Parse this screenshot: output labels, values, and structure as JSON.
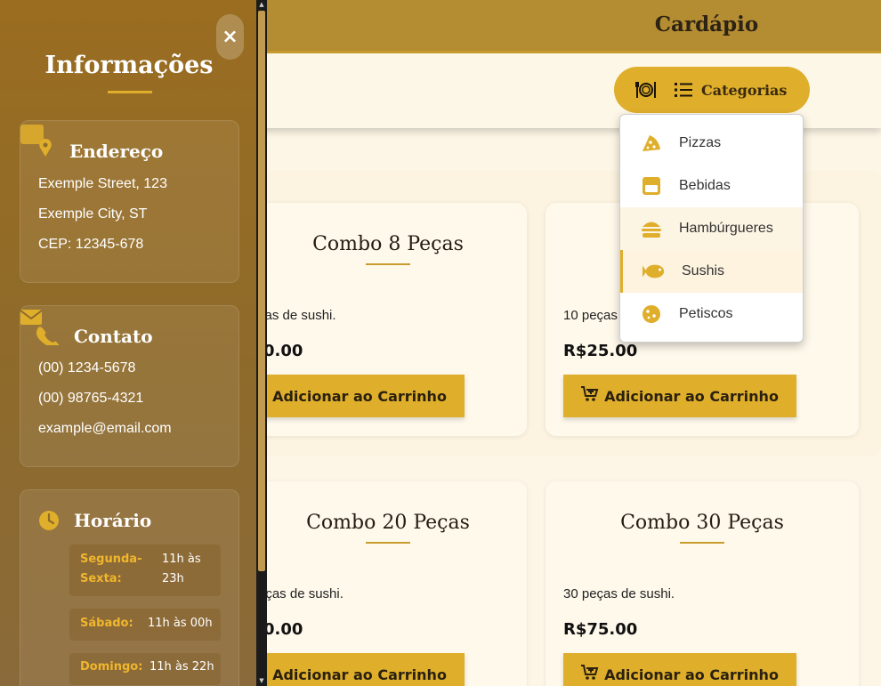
{
  "header": {
    "title": "Cardápio"
  },
  "categories": {
    "button_label": "Categorias",
    "items": [
      {
        "label": "Pizzas",
        "icon": "pizza-slice-icon"
      },
      {
        "label": "Bebidas",
        "icon": "glass-icon"
      },
      {
        "label": "Hambúrgueres",
        "icon": "burger-icon"
      },
      {
        "label": "Sushis",
        "icon": "fish-icon"
      },
      {
        "label": "Petiscos",
        "icon": "cookie-icon"
      }
    ]
  },
  "products": [
    {
      "title": "Combo 8 Peças",
      "desc": "ças de sushi.",
      "price": "0.00",
      "button": "Adicionar ao Carrinho"
    },
    {
      "title": "",
      "desc": "10 peças",
      "price": "R$25.00",
      "button": "Adicionar ao Carrinho"
    },
    {
      "title": "Combo 20 Peças",
      "desc": "eças de sushi.",
      "price": "0.00",
      "button": "Adicionar ao Carrinho"
    },
    {
      "title": "Combo 30 Peças",
      "desc": "30 peças de sushi.",
      "price": "R$75.00",
      "button": "Adicionar ao Carrinho"
    }
  ],
  "sidebar": {
    "title": "Informações",
    "close": "×",
    "address": {
      "heading": "Endereço",
      "lines": [
        "Exemple Street, 123",
        "Exemple City, ST",
        "CEP: 12345-678"
      ]
    },
    "contact": {
      "heading": "Contato",
      "lines": [
        "(00) 1234-5678",
        "(00) 98765-4321",
        "example@email.com"
      ]
    },
    "hours": {
      "heading": "Horário",
      "rows": [
        {
          "day_line1": "Segunda-",
          "day_line2": "Sexta:",
          "time_line1": "11h às",
          "time_line2": "23h"
        },
        {
          "day": "Sábado:",
          "time": "11h às 00h"
        },
        {
          "day": "Domingo:",
          "time": "11h às 22h"
        }
      ]
    }
  },
  "colors": {
    "gold": "#dfae2b",
    "header": "#b48c32",
    "sidebar": "#9a6d20",
    "page": "#fdf6e6"
  }
}
